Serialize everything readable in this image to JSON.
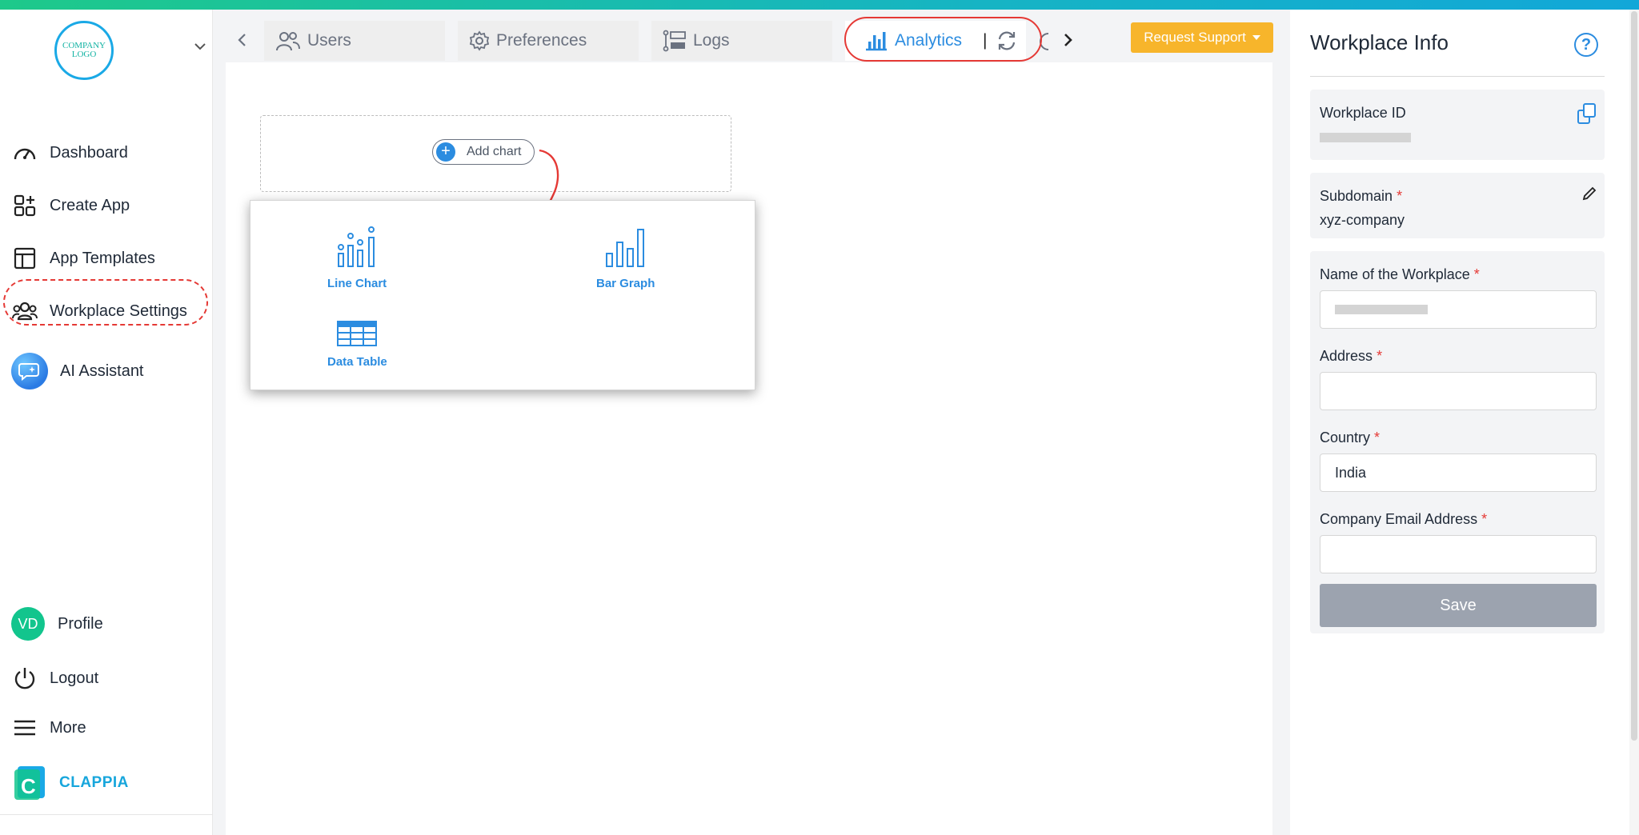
{
  "sidebar": {
    "logo_text": "COMPANY LOGO",
    "items": [
      {
        "label": "Dashboard",
        "icon": "speedometer-icon"
      },
      {
        "label": "Create App",
        "icon": "create-app-icon"
      },
      {
        "label": "App Templates",
        "icon": "templates-icon"
      },
      {
        "label": "Workplace Settings",
        "icon": "users-group-icon"
      },
      {
        "label": "AI Assistant",
        "icon": "ai-chat-icon"
      }
    ],
    "profile": {
      "initials": "VD",
      "label": "Profile"
    },
    "logout_label": "Logout",
    "more_label": "More",
    "brand": "CLAPPIA"
  },
  "tabs": [
    {
      "label": "Users",
      "icon": "users-icon"
    },
    {
      "label": "Preferences",
      "icon": "gear-icon"
    },
    {
      "label": "Logs",
      "icon": "logs-icon"
    },
    {
      "label": "Analytics",
      "icon": "bar-chart-icon",
      "active": true
    }
  ],
  "analytics_separator": "|",
  "request_support": "Request Support",
  "canvas": {
    "add_chart": "Add chart",
    "options": [
      {
        "label": "Line Chart",
        "icon": "line-chart-icon"
      },
      {
        "label": "Bar Graph",
        "icon": "bar-graph-icon"
      },
      {
        "label": "Data Table",
        "icon": "data-table-icon"
      }
    ]
  },
  "panel": {
    "title": "Workplace Info",
    "workplace_id_label": "Workplace ID",
    "subdomain_label": "Subdomain",
    "subdomain_value": "xyz-company",
    "name_label": "Name of the Workplace",
    "address_label": "Address",
    "country_label": "Country",
    "country_value": "India",
    "email_label": "Company Email Address",
    "required_mark": "*",
    "save": "Save"
  },
  "colors": {
    "accent": "#2b8ce0",
    "highlight": "#e53935",
    "request_button": "#f7b52b",
    "save_disabled": "#9ca3af",
    "brand_green": "#12c58d"
  }
}
